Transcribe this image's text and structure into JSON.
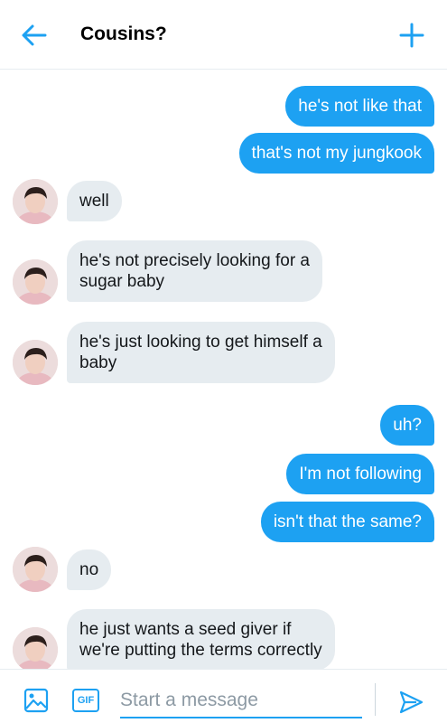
{
  "header": {
    "title": "Cousins?",
    "back_icon": "arrow-left-icon",
    "action_icon": "plus-icon"
  },
  "accent_color": "#1da1f2",
  "incoming_bubble_color": "#e6ecf0",
  "messages": [
    {
      "direction": "out",
      "lines": [
        "he's not like that"
      ]
    },
    {
      "direction": "out",
      "lines": [
        "that's not my jungkook"
      ]
    },
    {
      "direction": "in",
      "lines": [
        "well"
      ]
    },
    {
      "direction": "in",
      "lines": [
        "he's not precisely looking for a",
        "sugar baby"
      ]
    },
    {
      "direction": "in",
      "lines": [
        "he's just looking to get himself a",
        "baby"
      ]
    },
    {
      "direction": "out",
      "lines": [
        "uh?"
      ]
    },
    {
      "direction": "out",
      "lines": [
        "I'm not following"
      ]
    },
    {
      "direction": "out",
      "lines": [
        "isn't that the same?"
      ]
    },
    {
      "direction": "in",
      "lines": [
        "no"
      ]
    },
    {
      "direction": "in",
      "lines": [
        "he just wants a seed giver if",
        "we're putting the terms correctly"
      ]
    }
  ],
  "composer": {
    "placeholder": "Start a message",
    "gif_label": "GIF",
    "image_icon": "image-icon",
    "send_icon": "send-icon"
  }
}
